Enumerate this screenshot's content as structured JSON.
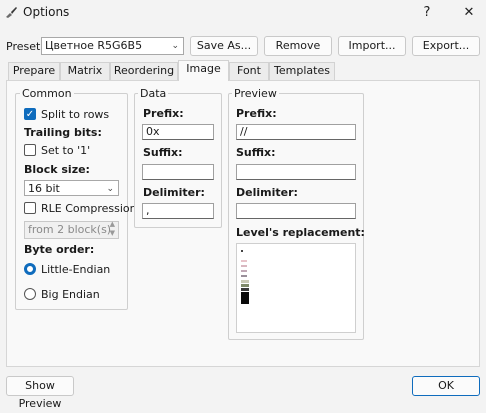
{
  "window": {
    "title": "Options",
    "help": "?",
    "close": "✕"
  },
  "preset": {
    "label": "Preset:",
    "value": "Цветное R5G6B5"
  },
  "buttons": {
    "save_as": "Save As...",
    "remove": "Remove",
    "import": "Import...",
    "export": "Export...",
    "show_preview": "Show Preview",
    "ok": "OK"
  },
  "tabs": [
    "Prepare",
    "Matrix",
    "Reordering",
    "Image",
    "Font",
    "Templates"
  ],
  "common": {
    "title": "Common",
    "split_to_rows": "Split to rows",
    "trailing_bits": "Trailing bits:",
    "set_to_1": "Set to '1'",
    "block_size": "Block size:",
    "block_size_value": "16 bit",
    "rle": "RLE Compression",
    "rle_from": "from 2 block(s)",
    "byte_order": "Byte order:",
    "little_endian": "Little-Endian",
    "big_endian": "Big Endian"
  },
  "data": {
    "title": "Data",
    "prefix_label": "Prefix:",
    "prefix_value": "0x",
    "suffix_label": "Suffix:",
    "suffix_value": "",
    "delimiter_label": "Delimiter:",
    "delimiter_value": ","
  },
  "preview": {
    "title": "Preview",
    "prefix_label": "Prefix:",
    "prefix_value": "//",
    "suffix_label": "Suffix:",
    "suffix_value": "",
    "delimiter_label": "Delimiter:",
    "delimiter_value": "",
    "levels_label": "Level's replacement:"
  }
}
